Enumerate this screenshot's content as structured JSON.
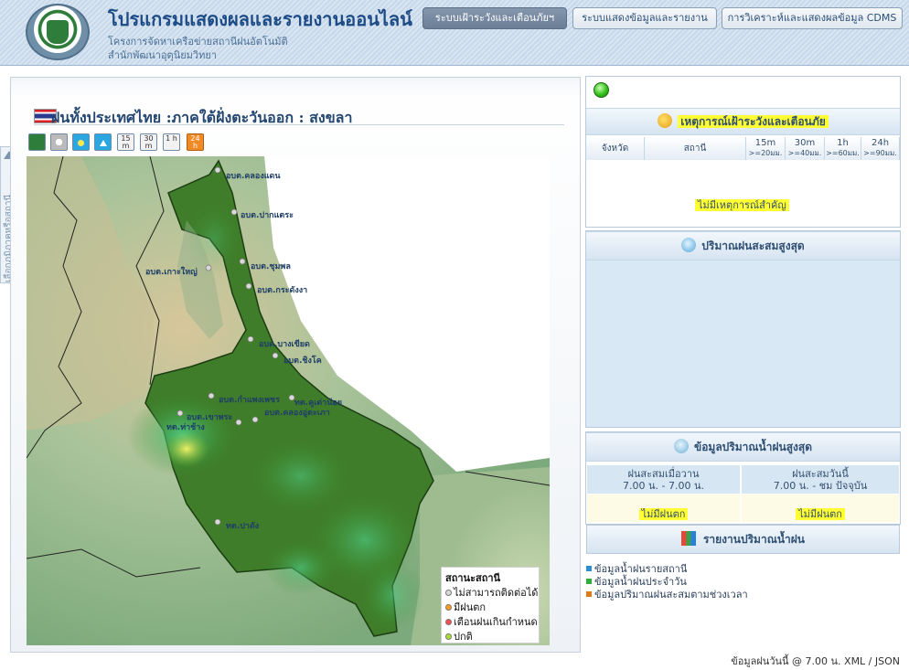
{
  "header": {
    "title": "โปรแกรมแสดงผลและรายงานออนไลน์",
    "subtitle1": "โครงการจัดหาเครือข่ายสถานีฝนอัตโนมัติ",
    "subtitle2": "สำนักพัฒนาอุตุนิยมวิทยา",
    "tabs": [
      "ระบบเฝ้าระวังและเตือนภัยฯ",
      "ระบบแสดงข้อมูลและรายงาน",
      "การวิเคราะห์และแสดงผลข้อมูล CDMS"
    ]
  },
  "sidetab": {
    "label": "เลือกภูมิภาคหรือสถานี"
  },
  "map_panel": {
    "title": "ฝนทั้งประเทศไทย :ภาคใต้ฝั่งตะวันออก : สงขลา",
    "tools": [
      "",
      "",
      "",
      "",
      "15 m",
      "30 m",
      "1 h",
      "24 h"
    ],
    "stations": [
      "อบต.คลองแดน",
      "อบต.ปากแตระ",
      "อบต.เกาะใหญ่",
      "อบต.ชุมพล",
      "อบต.กระดังงา",
      "อบต.บางเขียด",
      "อบต.ชิงโค",
      "อบต.กำแพงเพชร",
      "ทต.คูเต่าน้อย",
      "อบต.คลองอู่ตะเภา",
      "อบต.เขาพระ",
      "ทต.ท่าช้าง",
      "ทต.ปาดัง"
    ],
    "legend": {
      "title": "สถานะสถานี",
      "items": [
        "ไม่สามารถติดต่อได้",
        "มีฝนตก",
        "เตือนฝนเกินกำหนด",
        "ปกติ"
      ],
      "colors": [
        "#d9d9d9",
        "#ff9f1a",
        "#ff4d4d",
        "#a6e22e"
      ]
    }
  },
  "warning_panel": {
    "title": "เหตุการณ์เฝ้าระวังและเตือนภัย",
    "columns": {
      "province": "จังหวัด",
      "station": "สถานี",
      "c15m": "15m",
      "c15m_sub": ">=20มม.",
      "c30m": "30m",
      "c30m_sub": ">=40มม.",
      "c1h": "1h",
      "c1h_sub": ">=60มม.",
      "c24h": "24h",
      "c24h_sub": ">=90มม."
    },
    "empty_message": "ไม่มีเหตุการณ์สำคัญ"
  },
  "max_rain_panel": {
    "title": "ปริมาณฝนสะสมสูงสุด"
  },
  "max_rain_data_panel": {
    "title": "ข้อมูลปริมาณน้ำฝนสูงสุด",
    "yesterday_title": "ฝนสะสมเมื่อวาน",
    "yesterday_range": "7.00 น. - 7.00 น.",
    "today_title": "ฝนสะสมวันนี้",
    "today_range": "7.00 น. - ชม ปัจจุบัน",
    "yesterday_value": "ไม่มีฝนตก",
    "today_value": "ไม่มีฝนตก"
  },
  "report_panel": {
    "title": "รายงานปริมาณน้ำฝน",
    "links": [
      "ข้อมูลน้ำฝนรายสถานี",
      "ข้อมูลน้ำฝนประจำวัน",
      "ข้อมูลปริมาณฝนสะสมตามช่วงเวลา"
    ],
    "link_colors": [
      "#2a8fd6",
      "#2fae3a",
      "#e07a14"
    ]
  },
  "footer": {
    "text": "ข้อมูลฝนวันนี้ @ 7.00 น. XML / JSON"
  }
}
